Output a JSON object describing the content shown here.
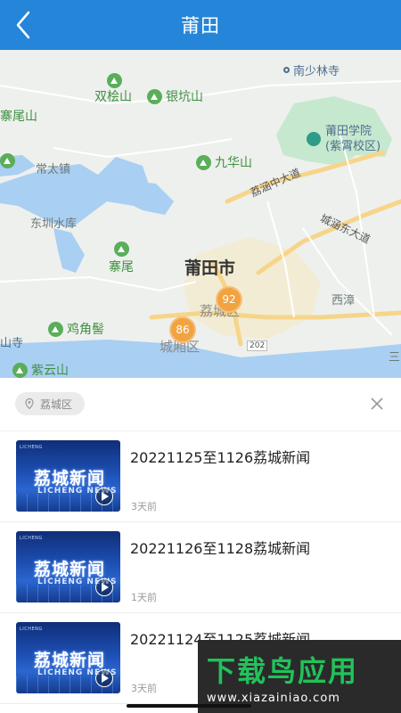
{
  "header": {
    "title": "莆田",
    "back_icon": "chevron-left-icon"
  },
  "map": {
    "city_label": "莆田市",
    "district_labels": [
      "荔城区",
      "城厢区"
    ],
    "pois_green": [
      "双桧山",
      "银坑山",
      "寨尾山",
      "九华山",
      "寨尾",
      "鸡角髻",
      "紫云山"
    ],
    "place_labels": [
      "常太镇",
      "东圳水库",
      "西漳",
      "山寺",
      "三"
    ],
    "blue_poi": "南少林寺",
    "school": {
      "line1": "莆田学院",
      "line2": "(紫霄校区)"
    },
    "roads": [
      "荔涵中大道",
      "城涵东大道",
      "202"
    ],
    "clusters": [
      {
        "count": "92"
      },
      {
        "count": "86"
      }
    ]
  },
  "filter": {
    "chip_label": "荔城区",
    "close_icon": "close-icon"
  },
  "news": [
    {
      "title": "20221125至1126荔城新闻",
      "time": "3天前",
      "thumb_cn": "荔城新闻",
      "thumb_en": "LICHENG NEWS",
      "thumb_tag": "LICHENG"
    },
    {
      "title": "20221126至1128荔城新闻",
      "time": "1天前",
      "thumb_cn": "荔城新闻",
      "thumb_en": "LICHENG NEWS",
      "thumb_tag": "LICHENG"
    },
    {
      "title": "20221124至1125荔城新闻",
      "time": "3天前",
      "thumb_cn": "荔城新闻",
      "thumb_en": "LICHENG NEWS",
      "thumb_tag": "LICHENG"
    }
  ],
  "watermark": {
    "title": "下载鸟应用",
    "url": "www.xiazainiao.com"
  }
}
